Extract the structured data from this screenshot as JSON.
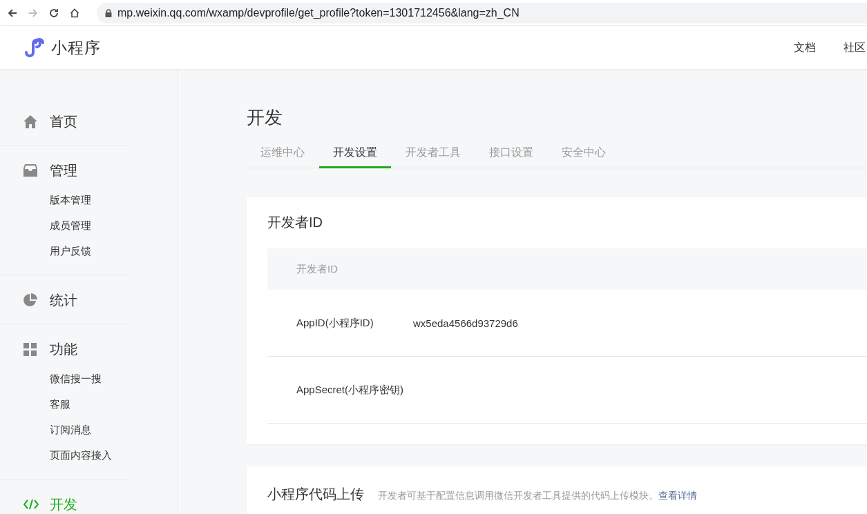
{
  "browser": {
    "url": "mp.weixin.qq.com/wxamp/devprofile/get_profile?token=1301712456&lang=zh_CN"
  },
  "header": {
    "brand": "小程序",
    "links": [
      "文档",
      "社区"
    ]
  },
  "sidebar": {
    "groups": [
      {
        "title": "首页",
        "selected": false
      },
      {
        "title": "管理",
        "selected": false,
        "items": [
          "版本管理",
          "成员管理",
          "用户反馈"
        ]
      },
      {
        "title": "统计",
        "selected": false
      },
      {
        "title": "功能",
        "selected": false,
        "items": [
          "微信搜一搜",
          "客服",
          "订阅消息",
          "页面内容接入"
        ]
      },
      {
        "title": "开发",
        "selected": true
      }
    ]
  },
  "page": {
    "title": "开发",
    "tabs": [
      {
        "label": "运维中心",
        "selected": false
      },
      {
        "label": "开发设置",
        "selected": true
      },
      {
        "label": "开发者工具",
        "selected": false
      },
      {
        "label": "接口设置",
        "selected": false
      },
      {
        "label": "安全中心",
        "selected": false
      }
    ]
  },
  "developer_id_card": {
    "title": "开发者ID",
    "table_header": "开发者ID",
    "rows": [
      {
        "label": "AppID(小程序ID)",
        "value": "wx5eda4566d93729d6"
      },
      {
        "label": "AppSecret(小程序密钥)"
      }
    ]
  },
  "upload_card": {
    "title": "小程序代码上传",
    "description": "开发者可基于配置信息调用微信开发者工具提供的代码上传模块。",
    "link": "查看详情"
  }
}
